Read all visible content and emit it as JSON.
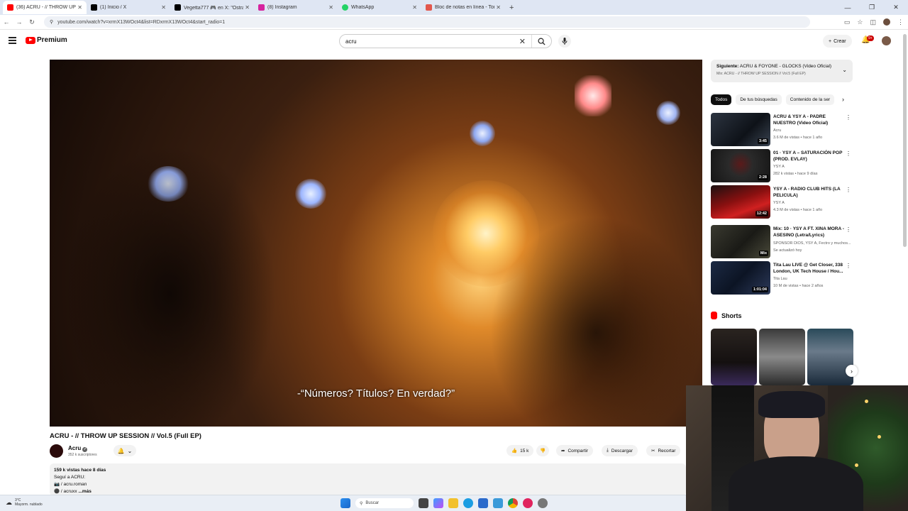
{
  "browser": {
    "tabs": [
      {
        "title": "(36) ACRU - // THROW UP",
        "color": "#ff0000",
        "active": true
      },
      {
        "title": "(1) Inicio / X",
        "color": "#000000",
        "active": false
      },
      {
        "title": "Vegetta777 🎮 en X: \"Ostra",
        "color": "#000000",
        "active": false
      },
      {
        "title": "(8) Instagram",
        "color": "#d6249f",
        "active": false
      },
      {
        "title": "WhatsApp",
        "color": "#25d366",
        "active": false
      },
      {
        "title": "Bloc de notas en línea - Toma y",
        "color": "#e2574c",
        "active": false
      }
    ],
    "url": "youtube.com/watch?v=xrmX13WOct4&list=RDxrmX13WOct4&start_radio=1"
  },
  "header": {
    "logo": "Premium",
    "search_value": "acru",
    "create_label": "Crear",
    "notif_count": "9+"
  },
  "video": {
    "subtitle": "-“Números? Títulos? En verdad?”",
    "title": "ACRU - // THROW UP SESSION // Vol.5 (Full EP)",
    "channel": "Acru",
    "subscribers": "352 k suscriptores",
    "likes": "15 k",
    "share": "Compartir",
    "download": "Descargar",
    "clip": "Recortar"
  },
  "description": {
    "stats": "159 k vistas  hace 8 días",
    "line1": "Seguí a ACRU:",
    "line2": "📷 / acru.roman",
    "line3": "⚫ / acruxx",
    "more": "...más"
  },
  "sidebar": {
    "next_label": "Siguiente:",
    "next_title": "ACRU & FOYONE - GLOCKS (Video Oficial)",
    "next_mix": "Mix: ACRU - // THROW UP SESSION // Vol.5 (Full EP)",
    "chips": [
      "Todos",
      "De tus búsquedas",
      "Contenido de la ser"
    ],
    "recs": [
      {
        "title": "ACRU & YSY A - PADRE NUESTRO (Video Oficial)",
        "channel": "Acru",
        "meta": "3.6 M de vistas • hace 1 año",
        "duration": "3:45"
      },
      {
        "title": "01 · YSY A – SATURACIÓN POP (PROD. EVLAY)",
        "channel": "YSY A",
        "meta": "282 k vistas • hace 9 días",
        "duration": "2:28"
      },
      {
        "title": "YSY A - RADIO CLUB HITS (LA PELICULA)",
        "channel": "YSY A",
        "meta": "4.3 M de vistas • hace 1 año",
        "duration": "12:42"
      },
      {
        "title": "Mix: 10 · YSY A FT. XINA MORA - ASESINO (Letra/Lyrics)",
        "channel": "SPONSOR DIOS, YSY A, Fectro y muchos...",
        "meta": "Se actualizó hoy",
        "duration": "Mix"
      },
      {
        "title": "Tita Lau LIVE @ Get Closer, 338 London, UK Tech House / Hou...",
        "channel": "Tita Lau",
        "meta": "10 M de vistas • hace 2 años",
        "duration": "1:01:04"
      }
    ],
    "shorts_label": "Shorts"
  },
  "taskbar": {
    "temp": "3°C",
    "weather": "Mayorm. nublado",
    "search": "Buscar"
  }
}
